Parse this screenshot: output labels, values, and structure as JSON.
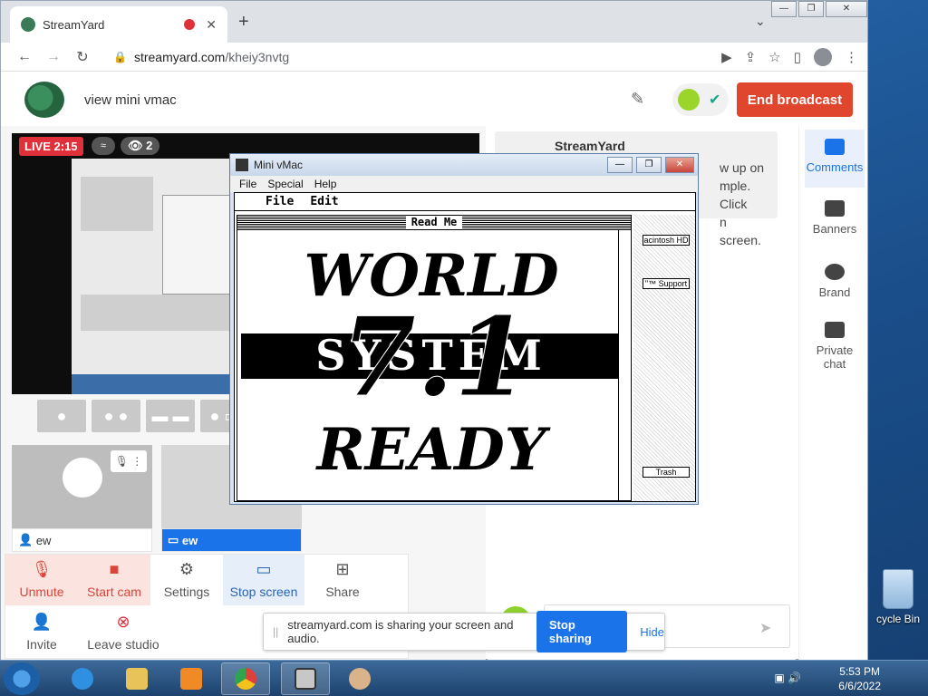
{
  "browser": {
    "tab_title": "StreamYard",
    "url_host": "streamyard.com",
    "url_path": "/kheiy3nvtg",
    "new_tab": "+",
    "close_tab": "✕"
  },
  "header": {
    "broadcast_title": "view mini vmac",
    "end_broadcast": "End broadcast"
  },
  "preview": {
    "live_label": "LIVE 2:15",
    "viewer_count": "2"
  },
  "participants": [
    {
      "name": "ew"
    },
    {
      "name": "ew"
    }
  ],
  "controls": {
    "unmute": "Unmute",
    "start_cam": "Start cam",
    "settings": "Settings",
    "stop_screen": "Stop screen",
    "share": "Share",
    "invite": "Invite",
    "leave_studio": "Leave studio"
  },
  "comments": {
    "author": "StreamYard",
    "text_lines": [
      "w up on",
      "mple. Click",
      "n screen."
    ]
  },
  "sidebar": {
    "comments": "Comments",
    "banners": "Banners",
    "brand": "Brand",
    "private_chat_1": "Private",
    "private_chat_2": "chat"
  },
  "share_bar": {
    "message": "streamyard.com is sharing your screen and audio.",
    "stop": "Stop sharing",
    "hide": "Hide"
  },
  "vmac": {
    "window_title": "Mini vMac",
    "menu": [
      "File",
      "Special",
      "Help"
    ],
    "mac_menu": [
      "File",
      "Edit"
    ],
    "readme_title": "Read Me",
    "art_lines": [
      "WORLD",
      "SYSTEM",
      "7.1",
      "READY"
    ],
    "disk_labels": [
      "acintosh HD",
      "\"™ Support",
      "Trash"
    ]
  },
  "desktop": {
    "recycle_bin": "cycle Bin"
  },
  "taskbar": {
    "time": "5:53 PM",
    "date": "6/6/2022"
  }
}
